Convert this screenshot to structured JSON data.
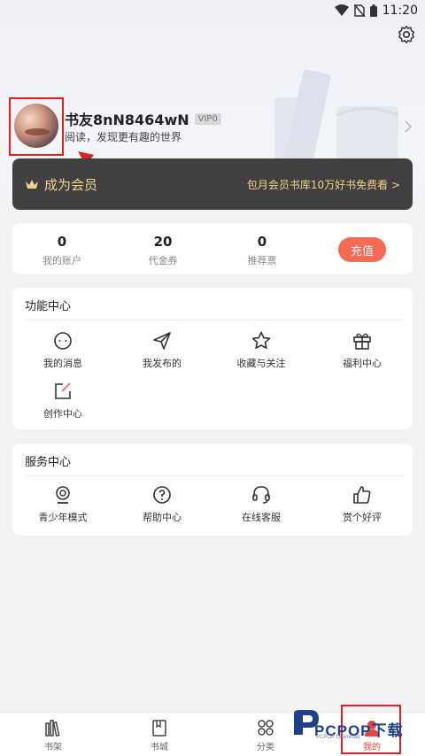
{
  "status_bar": {
    "time": "11:20"
  },
  "profile": {
    "username": "书友8nN8464wN",
    "vip_level": "VIP0",
    "slogan": "阅读，发现更有趣的世界"
  },
  "vip_banner": {
    "title": "成为会员",
    "promo": "包月会员书库10万好书免费看 >"
  },
  "stats": {
    "items": [
      {
        "value": "0",
        "label": "我的账户"
      },
      {
        "value": "20",
        "label": "代金券"
      },
      {
        "value": "0",
        "label": "推荐票"
      }
    ],
    "recharge_label": "充值"
  },
  "function_center": {
    "title": "功能中心",
    "items": [
      {
        "label": "我的消息",
        "icon": "message-icon"
      },
      {
        "label": "我发布的",
        "icon": "send-icon"
      },
      {
        "label": "收藏与关注",
        "icon": "star-icon"
      },
      {
        "label": "福利中心",
        "icon": "gift-icon"
      },
      {
        "label": "创作中心",
        "icon": "edit-icon"
      }
    ]
  },
  "service_center": {
    "title": "服务中心",
    "items": [
      {
        "label": "青少年模式",
        "icon": "youth-icon"
      },
      {
        "label": "帮助中心",
        "icon": "help-icon"
      },
      {
        "label": "在线客服",
        "icon": "headset-icon"
      },
      {
        "label": "赏个好评",
        "icon": "thumbs-up-icon"
      }
    ]
  },
  "tabbar": {
    "tabs": [
      {
        "label": "书架",
        "icon": "bookshelf-icon"
      },
      {
        "label": "书城",
        "icon": "bookstore-icon"
      },
      {
        "label": "分类",
        "icon": "category-icon"
      },
      {
        "label": "我的",
        "icon": "profile-icon",
        "active": true
      }
    ]
  },
  "watermark": {
    "text": "PCPOP下载",
    "sub": "PCPOP Download"
  },
  "colors": {
    "accent": "#f46a55",
    "vip_gold": "#f2cf8f",
    "vip_bg": "#404040",
    "highlight_red": "#e02020"
  }
}
